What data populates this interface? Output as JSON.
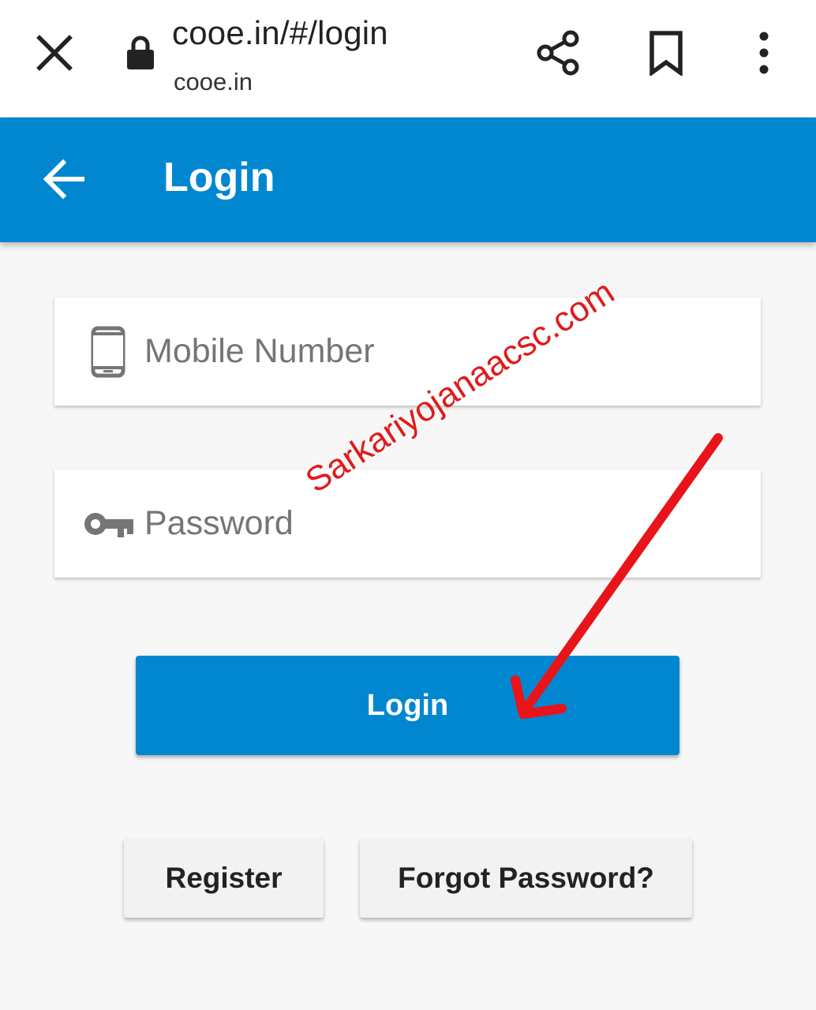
{
  "browser": {
    "url": "cooe.in/#/login",
    "domain": "cooe.in",
    "icons": [
      "close-icon",
      "lock-icon",
      "share-icon",
      "bookmark-icon",
      "more-vertical-icon"
    ]
  },
  "app_bar": {
    "title": "Login",
    "back_icon": "arrow-left-icon",
    "color": "#0187d0"
  },
  "form": {
    "mobile": {
      "placeholder": "Mobile Number",
      "icon": "phone-icon",
      "value": ""
    },
    "password": {
      "placeholder": "Password",
      "icon": "key-icon",
      "value": ""
    },
    "login_label": "Login",
    "register_label": "Register",
    "forgot_label": "Forgot Password?"
  },
  "watermark": {
    "text": "Sarkariyojanaacsc.com",
    "color": "#e01b1b"
  }
}
